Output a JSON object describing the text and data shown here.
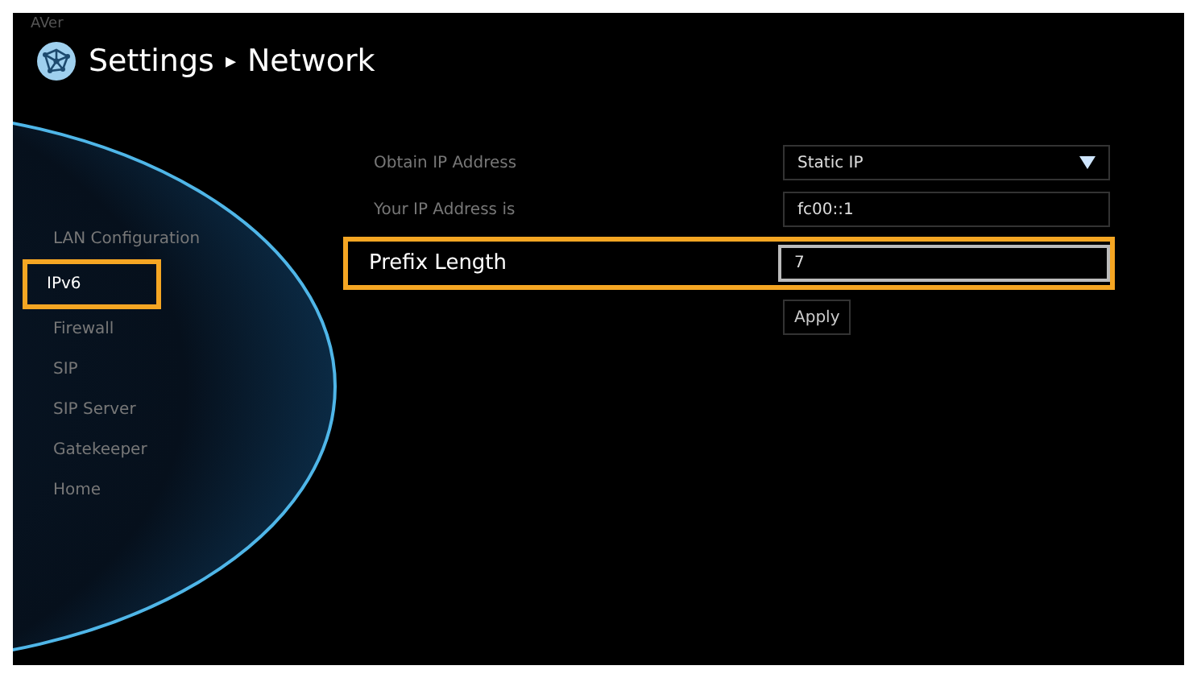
{
  "brand": "AVer",
  "header": {
    "title": "Settings",
    "crumb_separator": "▸",
    "section": "Network"
  },
  "sidebar": {
    "items": [
      {
        "label": "LAN Configuration",
        "selected": false
      },
      {
        "label": "IPv6",
        "selected": true
      },
      {
        "label": "Firewall",
        "selected": false
      },
      {
        "label": "SIP",
        "selected": false
      },
      {
        "label": "SIP Server",
        "selected": false
      },
      {
        "label": "Gatekeeper",
        "selected": false
      },
      {
        "label": "Home",
        "selected": false
      }
    ]
  },
  "form": {
    "rows": [
      {
        "kind": "dropdown",
        "label": "Obtain IP Address",
        "value": "Static IP",
        "focused": false
      },
      {
        "kind": "text",
        "label": "Your IP Address is",
        "value": "fc00::1",
        "focused": false
      },
      {
        "kind": "text",
        "label": "Prefix Length",
        "value": "7",
        "focused": true
      }
    ],
    "button": "Apply"
  }
}
